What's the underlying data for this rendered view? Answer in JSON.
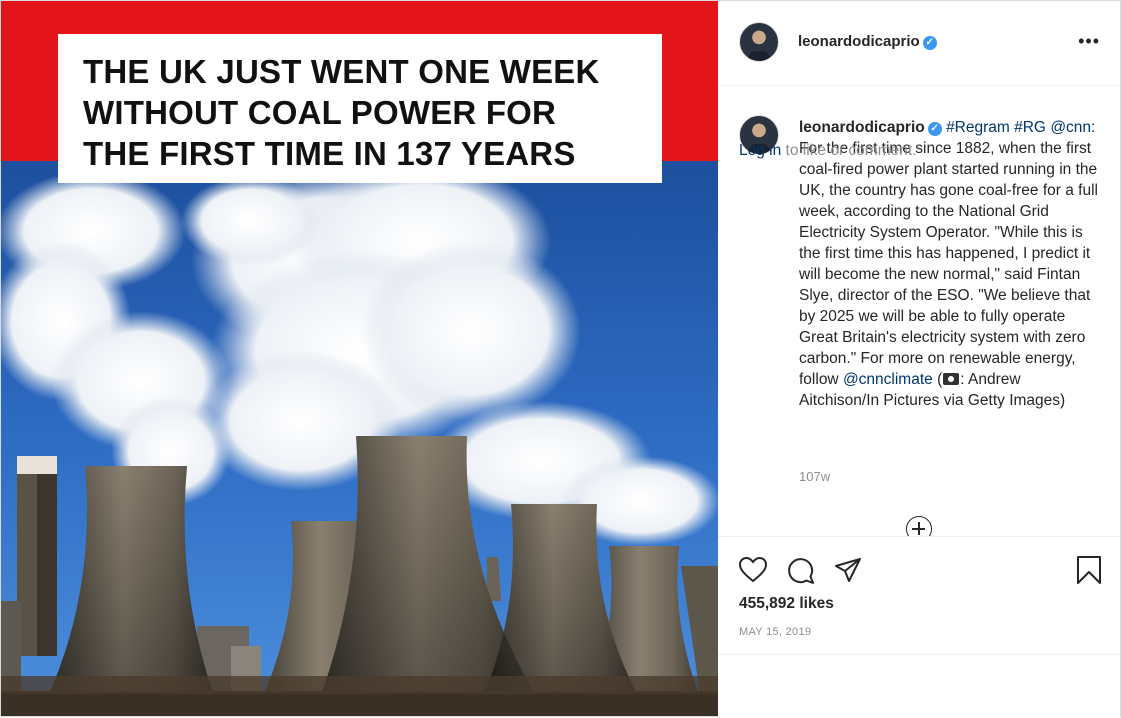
{
  "post_image": {
    "headline_lines": [
      "THE UK JUST WENT ONE WEEK",
      "WITHOUT COAL POWER FOR",
      "THE FIRST TIME IN 137 YEARS"
    ],
    "banner_color": "#e4141b"
  },
  "header": {
    "username": "leonardodicaprio",
    "verified_icon": "verified-badge",
    "more_label": "•••"
  },
  "caption": {
    "username": "leonardodicaprio",
    "tags": "#Regram #RG",
    "mention": "@cnn",
    "body1": ": For the first time since 1882, when the first coal-fired power plant started running in the UK, the country has gone coal-free for a full week, according to the National Grid Electricity System Operator. \"While this is the first time this has happened, I predict it will become the new normal,\" said Fintan Slye, director of the ESO. \"We believe that by 2025 we will be able to fully operate Great Britain's electricity system with zero carbon.\" For more on renewable energy, follow ",
    "mention2": "@cnnclimate",
    "body2_pre": " (",
    "body2_post": ": Andrew Aitchison/In Pictures via Getty Images)"
  },
  "time_ago": "107w",
  "actions": {
    "like_icon": "heart-icon",
    "comment_icon": "comment-icon",
    "share_icon": "share-icon",
    "save_icon": "bookmark-icon"
  },
  "likes": "455,892 likes",
  "date": "MAY 15, 2019",
  "comment": {
    "login_link": "Log in",
    "rest": " to like or comment."
  }
}
